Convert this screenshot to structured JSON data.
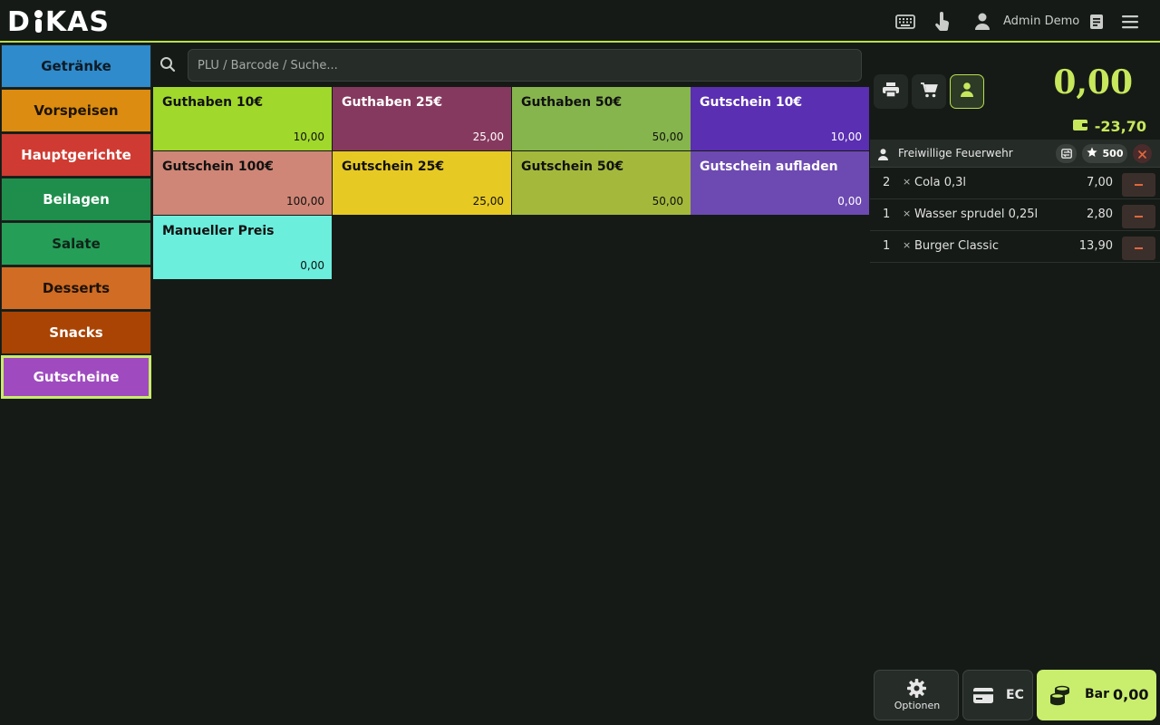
{
  "header": {
    "logo": "DIKAS",
    "logo_parts": [
      "D",
      "KAS"
    ],
    "user_name": "Admin Demo",
    "icons": [
      "keyboard-icon",
      "touch-icon",
      "user-icon",
      "journal-icon",
      "menu-icon"
    ],
    "accent_color": "#b7e04a"
  },
  "categories": [
    {
      "label": "Getränke",
      "color": "#2f8bcb",
      "text_color": "#0f1a24"
    },
    {
      "label": "Vorspeisen",
      "color": "#dc8c11",
      "text_color": "#1d1405"
    },
    {
      "label": "Hauptgerichte",
      "color": "#cf3b32",
      "text_color": "#ffffff"
    },
    {
      "label": "Beilagen",
      "color": "#1f8e4d",
      "text_color": "#ffffff"
    },
    {
      "label": "Salate",
      "color": "#259e58",
      "text_color": "#0f2418"
    },
    {
      "label": "Desserts",
      "color": "#d06c24",
      "text_color": "#1d1208"
    },
    {
      "label": "Snacks",
      "color": "#a94404",
      "text_color": "#ffffff"
    },
    {
      "label": "Gutscheine",
      "color": "#9f4bbf",
      "text_color": "#ffffff",
      "active": true
    }
  ],
  "search": {
    "placeholder": "PLU / Barcode / Suche..."
  },
  "products": [
    {
      "name": "Guthaben 10€",
      "price": "10,00",
      "color": "#a1d82c",
      "text_color": "#111111"
    },
    {
      "name": "Guthaben 25€",
      "price": "25,00",
      "color": "#86395e",
      "text_color": "#ffffff"
    },
    {
      "name": "Guthaben 50€",
      "price": "50,00",
      "color": "#86b54d",
      "text_color": "#111111"
    },
    {
      "name": "Gutschein 10€",
      "price": "10,00",
      "color": "#5a2fb2",
      "text_color": "#ffffff"
    },
    {
      "name": "Gutschein 100€",
      "price": "100,00",
      "color": "#cf8676",
      "text_color": "#111111"
    },
    {
      "name": "Gutschein 25€",
      "price": "25,00",
      "color": "#e7c923",
      "text_color": "#111111"
    },
    {
      "name": "Gutschein 50€",
      "price": "50,00",
      "color": "#a4b93b",
      "text_color": "#111111"
    },
    {
      "name": "Gutschein aufladen",
      "price": "0,00",
      "color": "#6d4ab2",
      "text_color": "#ffffff"
    },
    {
      "name": "Manueller Preis",
      "price": "0,00",
      "color": "#6ceedd",
      "text_color": "#111111"
    }
  ],
  "order": {
    "total": "0,00",
    "balance": "-23,70",
    "customer_name": "Freiwillige Feuerwehr Eggenfe...",
    "points": "500",
    "items": [
      {
        "qty": "2",
        "name": "Cola 0,3l",
        "price": "7,00"
      },
      {
        "qty": "1",
        "name": "Wasser sprudel 0,25l",
        "price": "2,80"
      },
      {
        "qty": "1",
        "name": "Burger Classic",
        "price": "13,90"
      }
    ]
  },
  "actions": {
    "options_label": "Optionen",
    "ec_label": "EC",
    "bar_label": "Bar",
    "bar_amount": "0,00"
  }
}
